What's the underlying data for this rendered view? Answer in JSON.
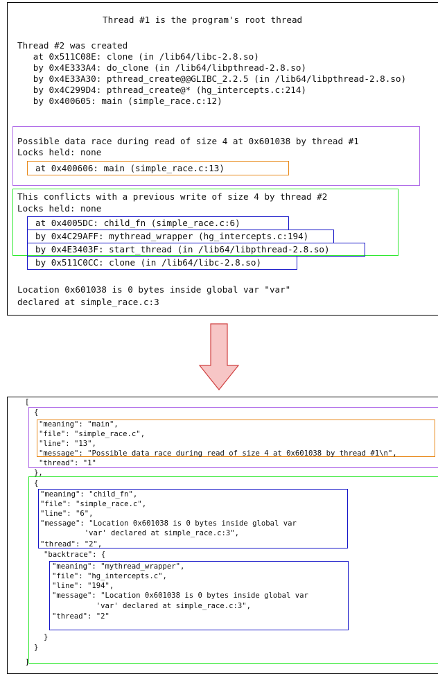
{
  "top": {
    "header": "Thread #1 is the program's root thread",
    "created": [
      "Thread #2 was created",
      "   at 0x511C08E: clone (in /lib64/libc-2.8.so)",
      "   by 0x4E333A4: do_clone (in /lib64/libpthread-2.8.so)",
      "   by 0x4E33A30: pthread_create@@GLIBC_2.2.5 (in /lib64/libpthread-2.8.so)",
      "   by 0x4C299D4: pthread_create@* (hg_intercepts.c:214)",
      "   by 0x400605: main (simple_race.c:12)"
    ],
    "race": [
      "Possible data race during read of size 4 at 0x601038 by thread #1",
      "Locks held: none"
    ],
    "race_frame": "at 0x400606: main (simple_race.c:13)",
    "conflict": [
      "This conflicts with a previous write of size 4 by thread #2",
      "Locks held: none"
    ],
    "conflict_frames": [
      "at 0x4005DC: child_fn (simple_race.c:6)",
      "by 0x4C29AFF: mythread_wrapper (hg_intercepts.c:194)",
      "by 0x4E3403F: start_thread (in /lib64/libpthread-2.8.so)",
      "by 0x511C0CC: clone (in /lib64/libc-2.8.so)"
    ],
    "location": [
      "Location 0x601038 is 0 bytes inside global var \"var\"",
      "declared at simple_race.c:3"
    ]
  },
  "bottom": {
    "open_bracket": "[",
    "open_brace_1": "{",
    "entry1": [
      "\"meaning\": \"main\",",
      "\"file\": \"simple_race.c\",",
      "\"line\": \"13\",",
      "\"message\": \"Possible data race during read of size 4 at 0x601038 by thread #1\\n\",",
      "\"thread\": \"1\""
    ],
    "close_brace_1": "},",
    "open_brace_2": "{",
    "entry2": [
      "\"meaning\": \"child_fn\",",
      "\"file\": \"simple_race.c\",",
      "\"line\": \"6\",",
      "\"message\": \"Location 0x601038 is 0 bytes inside global var",
      "          'var' declared at simple_race.c:3\",",
      "\"thread\": \"2\","
    ],
    "backtrace_label": "\"backtrace\": {",
    "backtrace": [
      "\"meaning\": \"mythread_wrapper\",",
      "\"file\": \"hg_intercepts.c\",",
      "\"line\": \"194\",",
      "\"message\": \"Location 0x601038 is 0 bytes inside global var",
      "          'var' declared at simple_race.c:3\",",
      "\"thread\": \"2\""
    ],
    "close_inner": "}",
    "close_brace_2": "}",
    "close_bracket": "]"
  },
  "colors": {
    "purple": "#b06ce8",
    "orange": "#e8891a",
    "green": "#2ee82e",
    "blue": "#1616c8",
    "arrow_fill": "#f7c6c6",
    "arrow_stroke": "#d04040"
  }
}
